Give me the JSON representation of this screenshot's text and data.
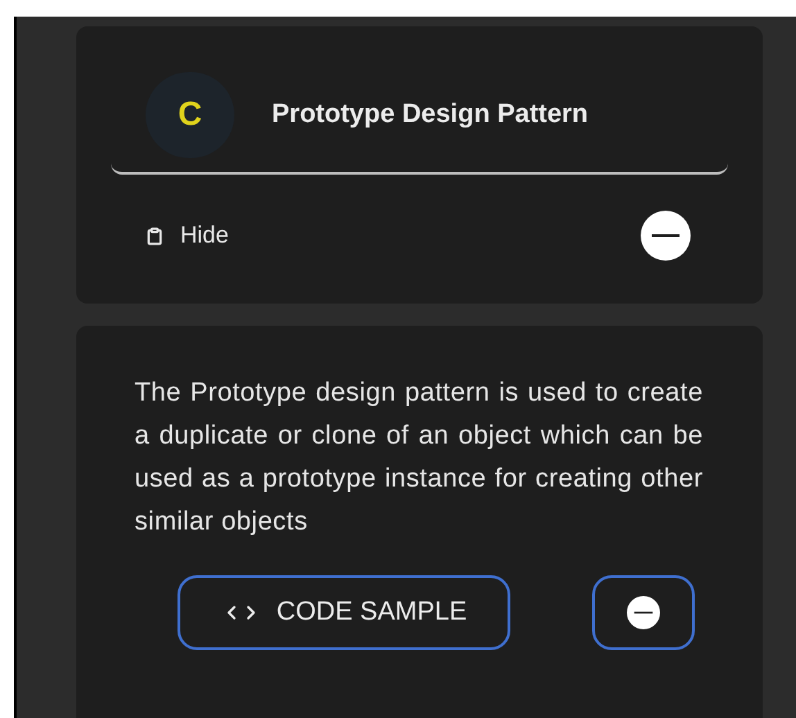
{
  "header_card": {
    "avatar_letter": "C",
    "title": "Prototype Design Pattern",
    "toggle_label": "Hide"
  },
  "description_card": {
    "text": "The Prototype design pattern is used to create a duplicate or clone of an object which can be used as a prototype instance for creating other similar objects",
    "code_button": "CODE SAMPLE"
  }
}
